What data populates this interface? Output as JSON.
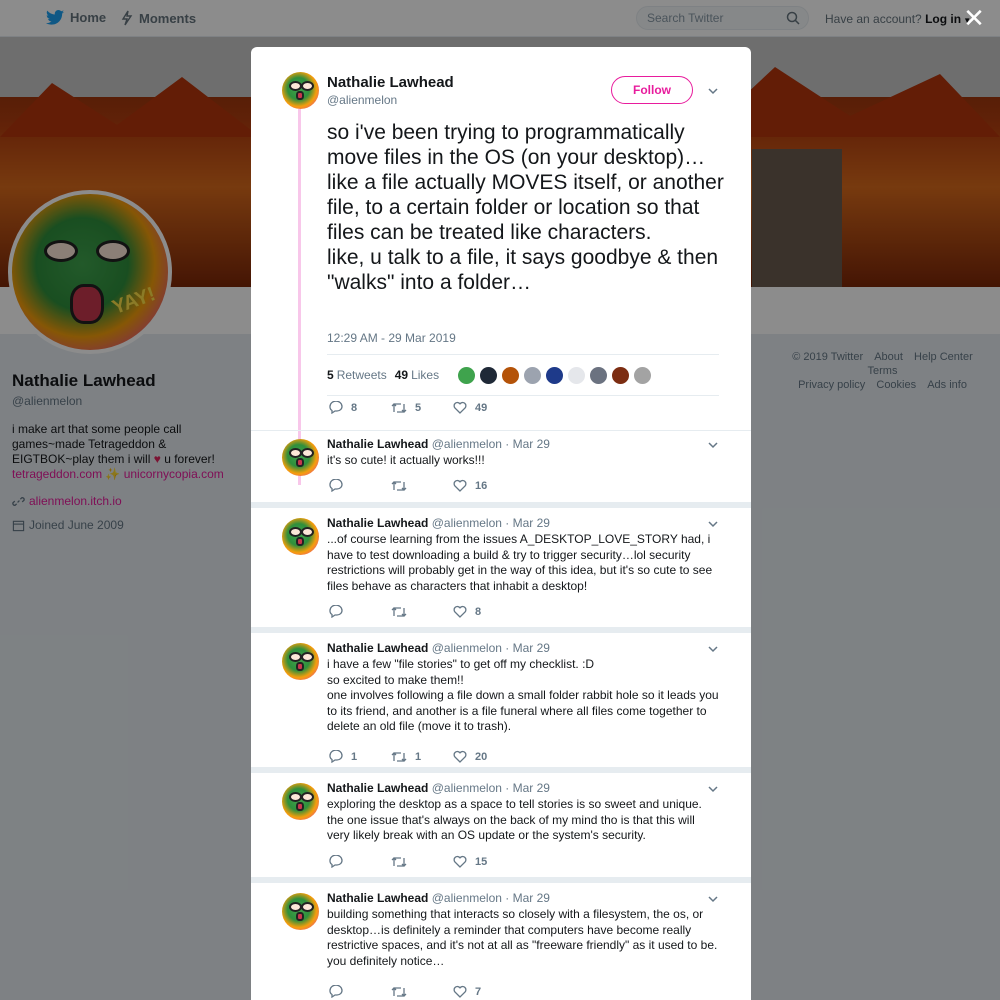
{
  "topbar": {
    "home_label": "Home",
    "moments_label": "Moments",
    "search_placeholder": "Search Twitter",
    "account_prompt": "Have an account?",
    "login_label": "Log in"
  },
  "profile": {
    "name": "Nathalie Lawhead",
    "handle": "@alienmelon",
    "bio_part1": "i make art that some people call games~made Tetrageddon & EIGTBOK~play them i will",
    "bio_part2": "u forever!",
    "bio_link1": "tetrageddon.com",
    "bio_link2": "unicornycopia.com",
    "website": "alienmelon.itch.io",
    "joined": "Joined June 2009"
  },
  "footer": {
    "links": [
      "© 2019 Twitter",
      "About",
      "Help Center",
      "Terms",
      "Privacy policy",
      "Cookies",
      "Ads info"
    ]
  },
  "main_tweet": {
    "name": "Nathalie Lawhead",
    "handle": "@alienmelon",
    "follow_label": "Follow",
    "text": "so i've been trying to programmatically move files in the OS (on your desktop)… like a file actually MOVES itself, or another file, to a certain folder or location so that files can be treated like characters.\nlike, u talk to a file, it says goodbye & then \"walks\" into a folder…",
    "timestamp": "12:29 AM - 29 Mar 2019",
    "retweets_count": "5",
    "retweets_label": "Retweets",
    "likes_count": "49",
    "likes_label": "Likes",
    "replies": "8",
    "retweets": "5",
    "likes": "49",
    "liker_colors": [
      "#3fa34d",
      "#1f2937",
      "#b45309",
      "#9ca3af",
      "#1e3a8a",
      "#e5e7eb",
      "#6b7280",
      "#7c2d12",
      "#a3a3a3"
    ]
  },
  "replies": [
    {
      "name": "Nathalie Lawhead",
      "handle": "@alienmelon",
      "date": "· Mar 29",
      "text": "it's so cute! it actually works!!!",
      "replies": "",
      "retweets": "",
      "likes": "16"
    },
    {
      "name": "Nathalie Lawhead",
      "handle": "@alienmelon",
      "date": "· Mar 29",
      "text": "...of course learning from the issues A_DESKTOP_LOVE_STORY had, i have to test downloading a build & try to trigger security…lol security restrictions will probably get in the way of this idea, but it's so cute to see files behave as characters that inhabit a desktop!",
      "replies": "",
      "retweets": "",
      "likes": "8"
    },
    {
      "name": "Nathalie Lawhead",
      "handle": "@alienmelon",
      "date": "· Mar 29",
      "text": "i have a few \"file stories\" to get off my checklist. :D\nso excited to make them!!\none involves following a file down a small folder rabbit hole so it leads you to its friend, and another is a file funeral where all files come together to delete an old file (move it to trash).",
      "replies": "1",
      "retweets": "1",
      "likes": "20"
    },
    {
      "name": "Nathalie Lawhead",
      "handle": "@alienmelon",
      "date": "· Mar 29",
      "text": "exploring the desktop as a space to tell stories is so sweet and unique. the one issue that's always on the back of my mind tho is that this will very likely break with an OS update or the system's security.",
      "replies": "",
      "retweets": "",
      "likes": "15"
    },
    {
      "name": "Nathalie Lawhead",
      "handle": "@alienmelon",
      "date": "· Mar 29",
      "text": "building something that interacts so closely with a filesystem, the os, or desktop…is definitely a reminder that computers have become really restrictive spaces, and it's not at all as \"freeware friendly\" as it used to be. you definitely notice…",
      "replies": "",
      "retweets": "",
      "likes": "7"
    }
  ],
  "colors": {
    "accent": "#e81c9d",
    "thread_line": "#f8c7ea",
    "muted": "#657786"
  }
}
